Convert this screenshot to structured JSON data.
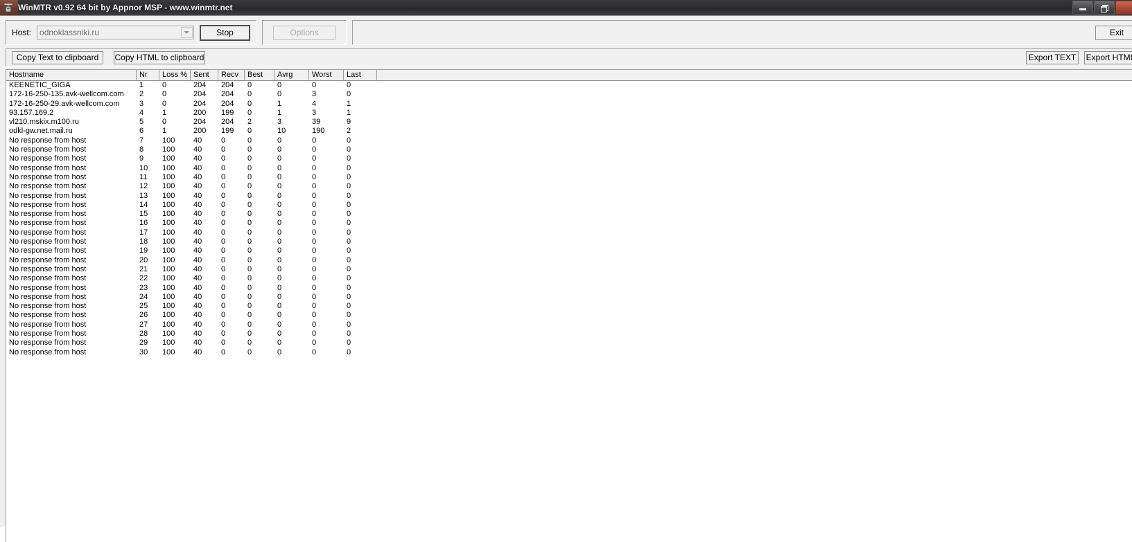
{
  "window": {
    "title": "WinMTR v0.92 64 bit by Appnor MSP - www.winmtr.net",
    "icon": "winmtr-app-icon",
    "controls": {
      "minimize": "minimize-icon",
      "restore": "restore-icon",
      "close": "close-icon"
    }
  },
  "toolbar": {
    "host_label": "Host:",
    "host_value": "odnoklassniki.ru",
    "host_placeholder": "odnoklassniki.ru",
    "stop_label": "Stop",
    "options_label": "Options",
    "exit_label": "Exit",
    "copy_text_label": "Copy Text to clipboard",
    "copy_html_label": "Copy HTML to clipboard",
    "export_text_label": "Export TEXT",
    "export_html_label": "Export HTML"
  },
  "table": {
    "columns": [
      "Hostname",
      "Nr",
      "Loss %",
      "Sent",
      "Recv",
      "Best",
      "Avrg",
      "Worst",
      "Last"
    ],
    "rows": [
      {
        "hostname": "KEENETIC_GIGA",
        "nr": "1",
        "loss": "0",
        "sent": "204",
        "recv": "204",
        "best": "0",
        "avrg": "0",
        "worst": "0",
        "last": "0"
      },
      {
        "hostname": "172-16-250-135.avk-wellcom.com",
        "nr": "2",
        "loss": "0",
        "sent": "204",
        "recv": "204",
        "best": "0",
        "avrg": "0",
        "worst": "3",
        "last": "0"
      },
      {
        "hostname": "172-16-250-29.avk-wellcom.com",
        "nr": "3",
        "loss": "0",
        "sent": "204",
        "recv": "204",
        "best": "0",
        "avrg": "1",
        "worst": "4",
        "last": "1"
      },
      {
        "hostname": "93.157.169.2",
        "nr": "4",
        "loss": "1",
        "sent": "200",
        "recv": "199",
        "best": "0",
        "avrg": "1",
        "worst": "3",
        "last": "1"
      },
      {
        "hostname": "vl210.mskix.m100.ru",
        "nr": "5",
        "loss": "0",
        "sent": "204",
        "recv": "204",
        "best": "2",
        "avrg": "3",
        "worst": "39",
        "last": "9"
      },
      {
        "hostname": "odkl-gw.net.mail.ru",
        "nr": "6",
        "loss": "1",
        "sent": "200",
        "recv": "199",
        "best": "0",
        "avrg": "10",
        "worst": "190",
        "last": "2"
      },
      {
        "hostname": "No response from host",
        "nr": "7",
        "loss": "100",
        "sent": "40",
        "recv": "0",
        "best": "0",
        "avrg": "0",
        "worst": "0",
        "last": "0"
      },
      {
        "hostname": "No response from host",
        "nr": "8",
        "loss": "100",
        "sent": "40",
        "recv": "0",
        "best": "0",
        "avrg": "0",
        "worst": "0",
        "last": "0"
      },
      {
        "hostname": "No response from host",
        "nr": "9",
        "loss": "100",
        "sent": "40",
        "recv": "0",
        "best": "0",
        "avrg": "0",
        "worst": "0",
        "last": "0"
      },
      {
        "hostname": "No response from host",
        "nr": "10",
        "loss": "100",
        "sent": "40",
        "recv": "0",
        "best": "0",
        "avrg": "0",
        "worst": "0",
        "last": "0"
      },
      {
        "hostname": "No response from host",
        "nr": "11",
        "loss": "100",
        "sent": "40",
        "recv": "0",
        "best": "0",
        "avrg": "0",
        "worst": "0",
        "last": "0"
      },
      {
        "hostname": "No response from host",
        "nr": "12",
        "loss": "100",
        "sent": "40",
        "recv": "0",
        "best": "0",
        "avrg": "0",
        "worst": "0",
        "last": "0"
      },
      {
        "hostname": "No response from host",
        "nr": "13",
        "loss": "100",
        "sent": "40",
        "recv": "0",
        "best": "0",
        "avrg": "0",
        "worst": "0",
        "last": "0"
      },
      {
        "hostname": "No response from host",
        "nr": "14",
        "loss": "100",
        "sent": "40",
        "recv": "0",
        "best": "0",
        "avrg": "0",
        "worst": "0",
        "last": "0"
      },
      {
        "hostname": "No response from host",
        "nr": "15",
        "loss": "100",
        "sent": "40",
        "recv": "0",
        "best": "0",
        "avrg": "0",
        "worst": "0",
        "last": "0"
      },
      {
        "hostname": "No response from host",
        "nr": "16",
        "loss": "100",
        "sent": "40",
        "recv": "0",
        "best": "0",
        "avrg": "0",
        "worst": "0",
        "last": "0"
      },
      {
        "hostname": "No response from host",
        "nr": "17",
        "loss": "100",
        "sent": "40",
        "recv": "0",
        "best": "0",
        "avrg": "0",
        "worst": "0",
        "last": "0"
      },
      {
        "hostname": "No response from host",
        "nr": "18",
        "loss": "100",
        "sent": "40",
        "recv": "0",
        "best": "0",
        "avrg": "0",
        "worst": "0",
        "last": "0"
      },
      {
        "hostname": "No response from host",
        "nr": "19",
        "loss": "100",
        "sent": "40",
        "recv": "0",
        "best": "0",
        "avrg": "0",
        "worst": "0",
        "last": "0"
      },
      {
        "hostname": "No response from host",
        "nr": "20",
        "loss": "100",
        "sent": "40",
        "recv": "0",
        "best": "0",
        "avrg": "0",
        "worst": "0",
        "last": "0"
      },
      {
        "hostname": "No response from host",
        "nr": "21",
        "loss": "100",
        "sent": "40",
        "recv": "0",
        "best": "0",
        "avrg": "0",
        "worst": "0",
        "last": "0"
      },
      {
        "hostname": "No response from host",
        "nr": "22",
        "loss": "100",
        "sent": "40",
        "recv": "0",
        "best": "0",
        "avrg": "0",
        "worst": "0",
        "last": "0"
      },
      {
        "hostname": "No response from host",
        "nr": "23",
        "loss": "100",
        "sent": "40",
        "recv": "0",
        "best": "0",
        "avrg": "0",
        "worst": "0",
        "last": "0"
      },
      {
        "hostname": "No response from host",
        "nr": "24",
        "loss": "100",
        "sent": "40",
        "recv": "0",
        "best": "0",
        "avrg": "0",
        "worst": "0",
        "last": "0"
      },
      {
        "hostname": "No response from host",
        "nr": "25",
        "loss": "100",
        "sent": "40",
        "recv": "0",
        "best": "0",
        "avrg": "0",
        "worst": "0",
        "last": "0"
      },
      {
        "hostname": "No response from host",
        "nr": "26",
        "loss": "100",
        "sent": "40",
        "recv": "0",
        "best": "0",
        "avrg": "0",
        "worst": "0",
        "last": "0"
      },
      {
        "hostname": "No response from host",
        "nr": "27",
        "loss": "100",
        "sent": "40",
        "recv": "0",
        "best": "0",
        "avrg": "0",
        "worst": "0",
        "last": "0"
      },
      {
        "hostname": "No response from host",
        "nr": "28",
        "loss": "100",
        "sent": "40",
        "recv": "0",
        "best": "0",
        "avrg": "0",
        "worst": "0",
        "last": "0"
      },
      {
        "hostname": "No response from host",
        "nr": "29",
        "loss": "100",
        "sent": "40",
        "recv": "0",
        "best": "0",
        "avrg": "0",
        "worst": "0",
        "last": "0"
      },
      {
        "hostname": "No response from host",
        "nr": "30",
        "loss": "100",
        "sent": "40",
        "recv": "0",
        "best": "0",
        "avrg": "0",
        "worst": "0",
        "last": "0"
      }
    ]
  },
  "colors": {
    "titlebar_accent": "#8e3a2b",
    "window_face": "#f0f0f0",
    "list_background": "#ffffff",
    "disabled_text": "#a8a8a8"
  }
}
